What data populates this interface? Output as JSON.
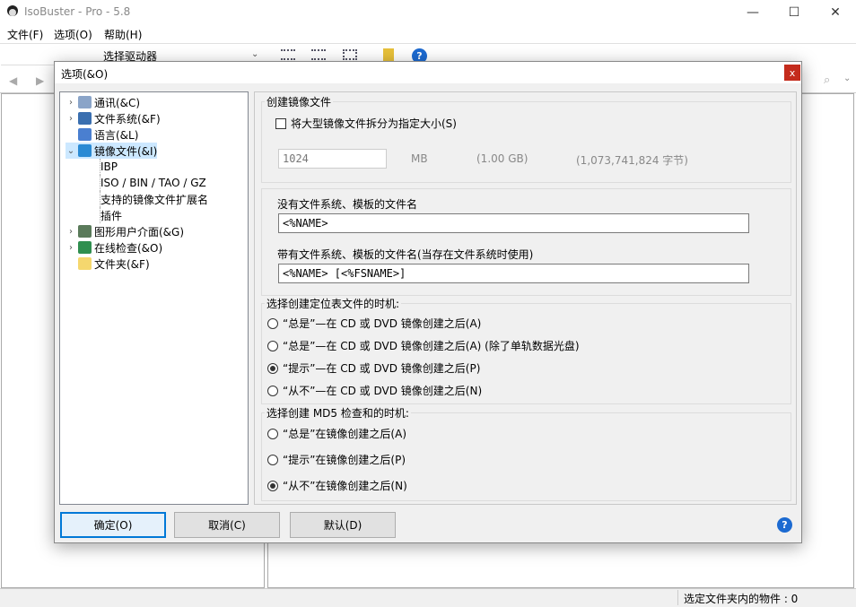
{
  "app": {
    "title": "IsoBuster - Pro - 5.8",
    "minimize": "—",
    "maximize": "☐",
    "close": "✕"
  },
  "menu": [
    "文件(F)",
    "选项(O)",
    "帮助(H)"
  ],
  "toolbar": {
    "drive_label": "选择驱动器"
  },
  "status": {
    "text": "选定文件夹内的物件 : 0"
  },
  "dialog": {
    "title": "选项(&O)",
    "close": "x",
    "tree": [
      {
        "label": "通讯(&C)",
        "arrow": ">",
        "icon": "gear-icon",
        "color": "#8aa4c8"
      },
      {
        "label": "文件系统(&F)",
        "arrow": ">",
        "icon": "filesystem-icon",
        "color": "#3a6fb0"
      },
      {
        "label": "语言(&L)",
        "arrow": "",
        "icon": "language-icon",
        "color": "#4a7fd0"
      },
      {
        "label": "镜像文件(&I)",
        "arrow": "v",
        "icon": "disc-icon",
        "color": "#2a8ad4",
        "selected": true
      },
      {
        "label": "IBP",
        "child": true
      },
      {
        "label": "ISO / BIN / TAO / GZ",
        "child": true
      },
      {
        "label": "支持的镜像文件扩展名",
        "child": true
      },
      {
        "label": "插件",
        "child": true
      },
      {
        "label": "图形用户介面(&G)",
        "arrow": ">",
        "icon": "gui-icon",
        "color": "#5a7a5a"
      },
      {
        "label": "在线检查(&O)",
        "arrow": ">",
        "icon": "globe-icon",
        "color": "#2f8f4f"
      },
      {
        "label": "文件夹(&F)",
        "arrow": "",
        "icon": "folder-icon",
        "color": "#f5d76e"
      }
    ],
    "create": {
      "group": "创建镜像文件",
      "split_label": "将大型镜像文件拆分为指定大小(S)",
      "split_checked": false,
      "size_value": "1024",
      "unit": "MB",
      "gb": "(1.00 GB)",
      "bytes": "(1,073,741,824 字节)"
    },
    "names": {
      "nofs_label": "没有文件系统、模板的文件名",
      "nofs_value": "<%NAME>",
      "withfs_label": "带有文件系统、模板的文件名(当存在文件系统时使用)",
      "withfs_value": "<%NAME> [<%FSNAME>]"
    },
    "locator": {
      "group": "选择创建定位表文件的时机:",
      "options": [
        "“总是”—在 CD 或 DVD 镜像创建之后(A)",
        "“总是”—在 CD 或 DVD 镜像创建之后(A) (除了单轨数据光盘)",
        "“提示”—在 CD 或 DVD 镜像创建之后(P)",
        "“从不”—在 CD 或 DVD 镜像创建之后(N)"
      ],
      "selected": 2
    },
    "md5": {
      "group": "选择创建 MD5 检查和的时机:",
      "options": [
        "“总是”在镜像创建之后(A)",
        "“提示”在镜像创建之后(P)",
        "“从不”在镜像创建之后(N)"
      ],
      "selected": 2
    },
    "buttons": {
      "ok": "确定(O)",
      "cancel": "取消(C)",
      "default": "默认(D)",
      "help": "?"
    }
  }
}
